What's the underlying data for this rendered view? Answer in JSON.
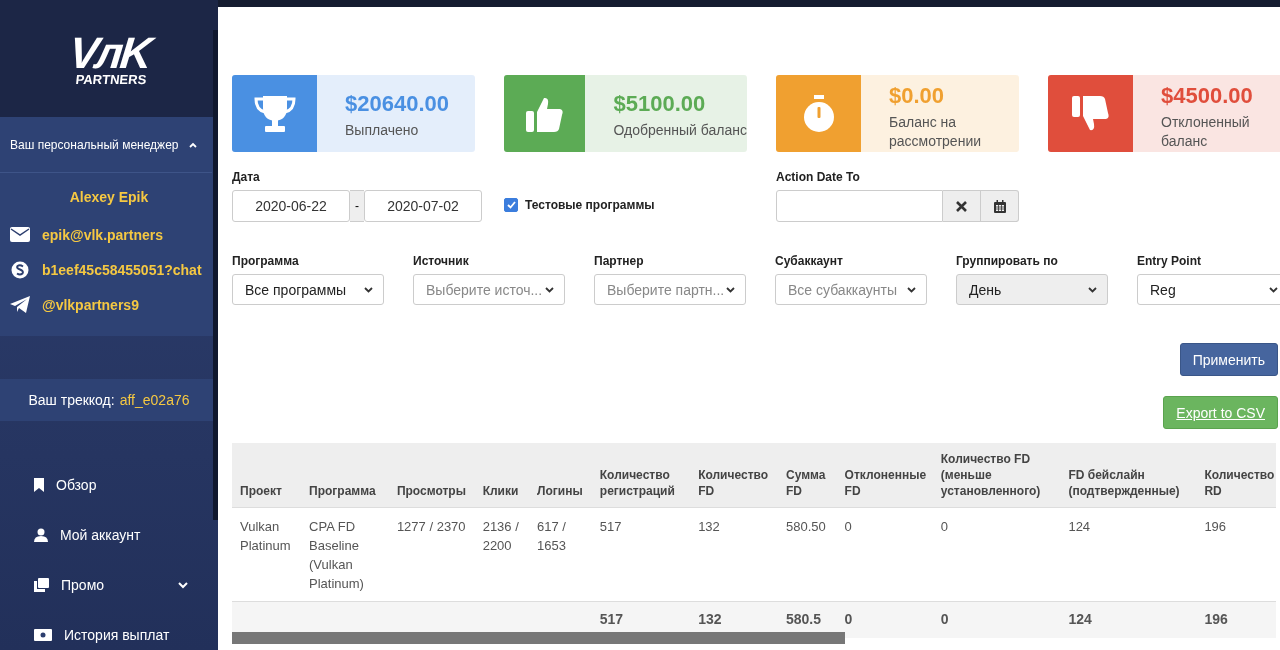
{
  "sidebar": {
    "logo": {
      "mark": "VлK",
      "sub": "PARTNERS"
    },
    "manager": {
      "title": "Ваш персональный менеджер",
      "expanded": true,
      "name": "Alexey Epik",
      "contacts": [
        {
          "kind": "email",
          "text": "epik@vlk.partners"
        },
        {
          "kind": "skype",
          "text": "b1eef45c58455051?chat"
        },
        {
          "kind": "telegram",
          "text": "@vlkpartners9"
        }
      ]
    },
    "trackcode": {
      "label": "Ваш треккод:",
      "value": "aff_e02a76"
    },
    "menu": [
      {
        "kind": "bookmark",
        "label": "Обзор",
        "has_submenu": false
      },
      {
        "kind": "user",
        "label": "Мой аккаунт",
        "has_submenu": false
      },
      {
        "kind": "promo",
        "label": "Промо",
        "has_submenu": true
      },
      {
        "kind": "money",
        "label": "История выплат",
        "has_submenu": false
      }
    ]
  },
  "cards": [
    {
      "kind": "trophy",
      "amount": "$20640.00",
      "label": "Выплачено",
      "color": "#4a90e2"
    },
    {
      "kind": "thumbs_up",
      "amount": "$5100.00",
      "label": "Одобренный баланс",
      "color": "#5cab55"
    },
    {
      "kind": "stopwatch",
      "amount": "$0.00",
      "label": "Баланс на рассмотрении",
      "color": "#f0a030"
    },
    {
      "kind": "thumbs_down",
      "amount": "$4500.00",
      "label": "Отклоненный баланс",
      "color": "#e04e3c"
    }
  ],
  "date_filter": {
    "label": "Дата",
    "from": "2020-06-22",
    "separator": "-",
    "to": "2020-07-02"
  },
  "test_programs": {
    "label": "Тестовые программы",
    "checked": true
  },
  "action_date_to": {
    "label": "Action Date To"
  },
  "filters": [
    {
      "label": "Программа",
      "value": "Все программы",
      "placeholder": false,
      "disabled": false
    },
    {
      "label": "Источник",
      "value": "Выберите источ...",
      "placeholder": true,
      "disabled": false
    },
    {
      "label": "Партнер",
      "value": "Выберите партн...",
      "placeholder": true,
      "disabled": false
    },
    {
      "label": "Субаккаунт",
      "value": "Все субаккаунты",
      "placeholder": true,
      "disabled": false
    },
    {
      "label": "Группировать по",
      "value": "День",
      "placeholder": false,
      "disabled": true
    },
    {
      "label": "Entry Point",
      "value": "Reg",
      "placeholder": false,
      "disabled": false
    }
  ],
  "apply_button": "Применить",
  "export_button": "Export to CSV",
  "table": {
    "columns": [
      "Проект",
      "Программа",
      "Просмотры",
      "Клики",
      "Логины",
      "Количество регистраций",
      "Количество FD",
      "Сумма FD",
      "Отклоненные FD",
      "Количество FD (меньше установленного)",
      "FD бейслайн (подтвержденные)",
      "Количество RD"
    ],
    "rows": [
      [
        "Vulkan Platinum",
        "CPA FD Baseline (Vulkan Platinum)",
        "1277 / 2370",
        "2136 / 2200",
        "617 / 1653",
        "517",
        "132",
        "580.50",
        "0",
        "0",
        "124",
        "196"
      ]
    ],
    "totals": [
      "517",
      "132",
      "580.5",
      "0",
      "0",
      "124",
      "196"
    ]
  }
}
